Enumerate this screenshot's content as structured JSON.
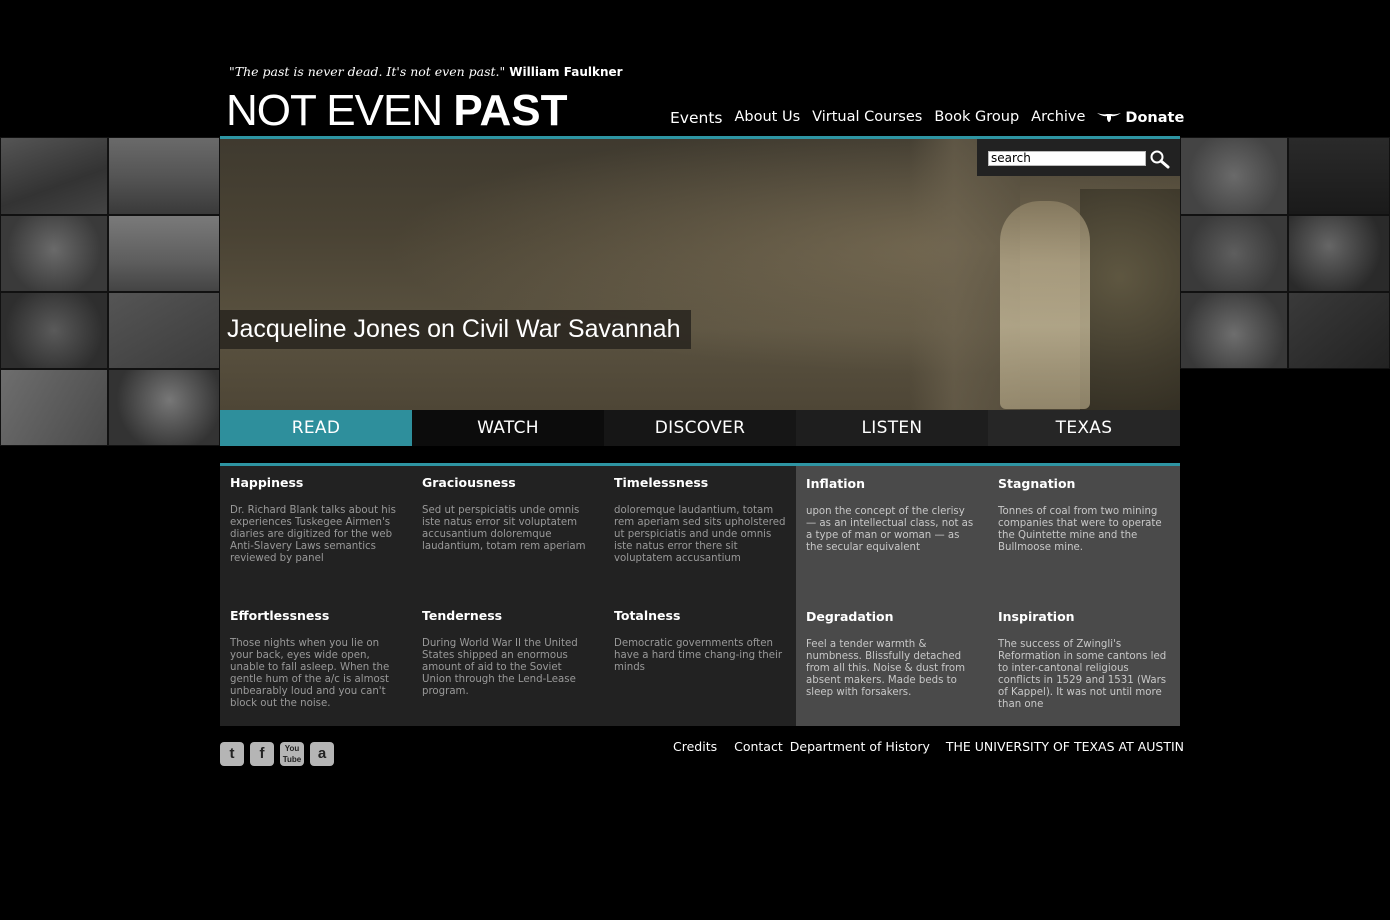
{
  "quote": {
    "text": "\"The past is never dead. It's not even past.\"",
    "author": "William Faulkner"
  },
  "logo": {
    "thin": "NOT EVEN ",
    "bold": "PAST"
  },
  "nav": {
    "items": [
      "Events",
      "About Us",
      "Virtual Courses",
      "Book Group",
      "Archive"
    ],
    "donate": "Donate"
  },
  "search": {
    "value": "search"
  },
  "hero": {
    "caption": "Jacqueline Jones on Civil War Savannah"
  },
  "tabs": [
    "READ",
    "WATCH",
    "DISCOVER",
    "LISTEN",
    "TEXAS"
  ],
  "cards": [
    {
      "title": "Happiness",
      "text": "Dr. Richard Blank talks about his experiences Tuskegee Airmen's diaries are digitized for the web Anti-Slavery Laws semantics reviewed by panel"
    },
    {
      "title": "Graciousness",
      "text": "Sed ut perspiciatis unde omnis iste natus error sit voluptatem accusantium doloremque laudantium, totam rem aperiam"
    },
    {
      "title": "Timelessness",
      "text": "doloremque laudantium, totam rem aperiam sed sits upholstered ut perspiciatis and unde omnis iste natus error there sit voluptatem accusantium"
    },
    {
      "title": "Inflation",
      "text": "upon the concept of the clerisy — as an intellectual class, not as a type of man or woman — as the secular equivalent"
    },
    {
      "title": "Stagnation",
      "text": "Tonnes of coal from two mining companies that were to operate the Quintette mine and the Bullmoose mine."
    },
    {
      "title": "Effortlessness",
      "text": "Those nights when you lie on your back, eyes wide open, unable to fall asleep. When the gentle hum of the a/c is almost unbearably loud and you can't block out the noise."
    },
    {
      "title": "Tenderness",
      "text": "During World War II the United States shipped an enormous amount of aid to the Soviet Union through the Lend-Lease program."
    },
    {
      "title": "Totalness",
      "text": "Democratic governments often have a hard time chang-ing their minds"
    },
    {
      "title": "Degradation",
      "text": "Feel a tender warmth & numbness. Blissfully detached from all this. Noise & dust from absent makers. Made beds to sleep with forsakers."
    },
    {
      "title": "Inspiration",
      "text": "The success of Zwingli's Reformation in some cantons led to inter-cantonal religious conflicts in 1529 and 1531 (Wars of Kappel). It was not until more than one"
    }
  ],
  "social": [
    {
      "name": "twitter",
      "glyph": "t"
    },
    {
      "name": "facebook",
      "glyph": "f"
    },
    {
      "name": "youtube",
      "glyph": "You Tube"
    },
    {
      "name": "amazon",
      "glyph": "a"
    }
  ],
  "footer": [
    "Credits",
    "Contact",
    "Department of History",
    "THE UNIVERSITY OF TEXAS AT AUSTIN"
  ],
  "colors": {
    "accent": "#2e95a3",
    "background": "#000000"
  }
}
